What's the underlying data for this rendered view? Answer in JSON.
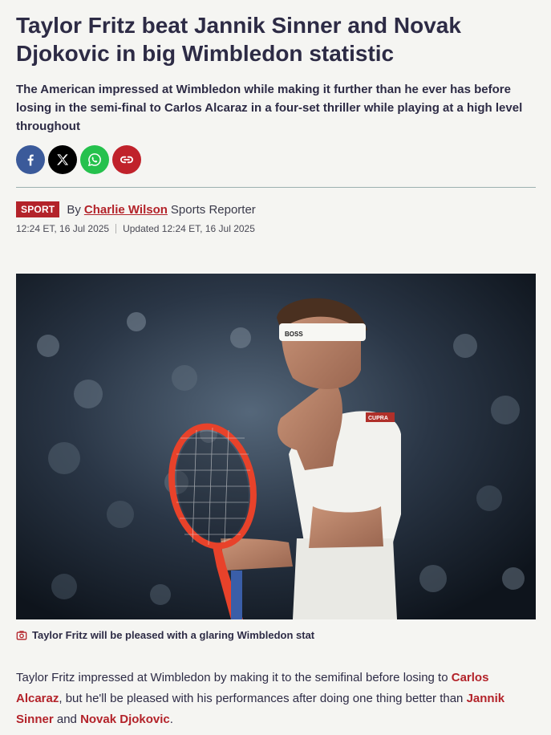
{
  "article": {
    "headline": "Taylor Fritz beat Jannik Sinner and Novak Djokovic in big Wimbledon statistic",
    "standfirst": "The American impressed at Wimbledon while making it further than he ever has before losing in the semi-final to Carlos Alcaraz in a four-set thriller while playing at a high level throughout",
    "section_tag": "SPORT",
    "by_label": "By",
    "author": "Charlie Wilson",
    "author_role": "Sports Reporter",
    "published": "12:24 ET, 16 Jul 2025",
    "updated": "Updated 12:24 ET, 16 Jul 2025",
    "caption": "Taylor Fritz will be pleased with a glaring Wimbledon stat",
    "body": {
      "p1_a": "Taylor Fritz impressed at Wimbledon by making it to the semifinal before losing to ",
      "link1": "Carlos Alcaraz",
      "p1_b": ", but he'll be pleased with his performances after doing one thing better than ",
      "link2": "Jannik Sinner",
      "p1_c": " and ",
      "link3": "Novak Djokovic",
      "p1_d": "."
    }
  },
  "share": {
    "items": [
      {
        "icon": "facebook-icon",
        "color": "#3b5a9a"
      },
      {
        "icon": "x-icon",
        "color": "#000000"
      },
      {
        "icon": "whatsapp-icon",
        "color": "#25c14d"
      },
      {
        "icon": "link-icon",
        "color": "#c0222b"
      }
    ]
  },
  "photo": {
    "headband_text": "BOSS",
    "shirt_badge": "CUPRA"
  },
  "colors": {
    "accent": "#b3232a",
    "headline": "#2d2b45",
    "background": "#f5f5f2"
  }
}
